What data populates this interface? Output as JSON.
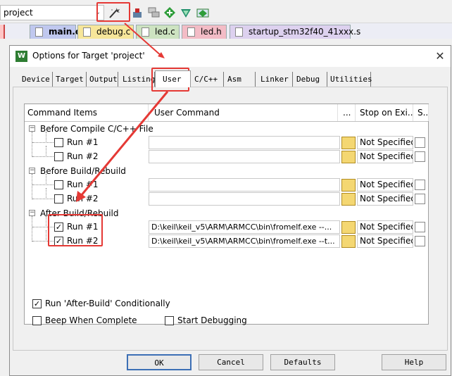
{
  "toolbar": {
    "project": "project"
  },
  "file_tabs": [
    {
      "label": "main.c",
      "bg": "#c0c8ef"
    },
    {
      "label": "debug.c",
      "bg": "#f7e69a"
    },
    {
      "label": "led.c",
      "bg": "#cde3c1"
    },
    {
      "label": "led.h",
      "bg": "#f3bcc6"
    },
    {
      "label": "startup_stm32f40_41xxx.s",
      "bg": "#ddd1ef"
    }
  ],
  "dialog": {
    "icon": "W",
    "title": "Options for Target 'project'",
    "close": "✕",
    "tabs": [
      "Device",
      "Target",
      "Output",
      "Listing",
      "User",
      "C/C++",
      "Asm",
      "Linker",
      "Debug",
      "Utilities"
    ],
    "table": {
      "headers": {
        "items": "Command Items",
        "cmd": "User Command",
        "dots": "...",
        "stop": "Stop on Exi...",
        "s": "S..."
      },
      "groups": [
        {
          "label": "Before Compile C/C++ File",
          "rows": [
            {
              "label": "Run #1",
              "checked": false,
              "cmd": "",
              "stop": "Not Specified"
            },
            {
              "label": "Run #2",
              "checked": false,
              "cmd": "",
              "stop": "Not Specified"
            }
          ]
        },
        {
          "label": "Before Build/Rebuild",
          "rows": [
            {
              "label": "Run #1",
              "checked": false,
              "cmd": "",
              "stop": "Not Specified"
            },
            {
              "label": "Run #2",
              "checked": false,
              "cmd": "",
              "stop": "Not Specified"
            }
          ]
        },
        {
          "label": "After Build/Rebuild",
          "rows": [
            {
              "label": "Run #1",
              "checked": true,
              "cmd": "D:\\keil\\keil_v5\\ARM\\ARMCC\\bin\\fromelf.exe --...",
              "stop": "Not Specified"
            },
            {
              "label": "Run #2",
              "checked": true,
              "cmd": "D:\\keil\\keil_v5\\ARM\\ARMCC\\bin\\fromelf.exe --t...",
              "stop": "Not Specified"
            }
          ]
        }
      ]
    },
    "options": {
      "after_build": "Run 'After-Build' Conditionally",
      "beep": "Beep When Complete",
      "start_debug": "Start Debugging"
    },
    "buttons": {
      "ok": "OK",
      "cancel": "Cancel",
      "defaults": "Defaults",
      "help": "Help"
    }
  },
  "colors": {
    "annotation": "#e53935"
  }
}
